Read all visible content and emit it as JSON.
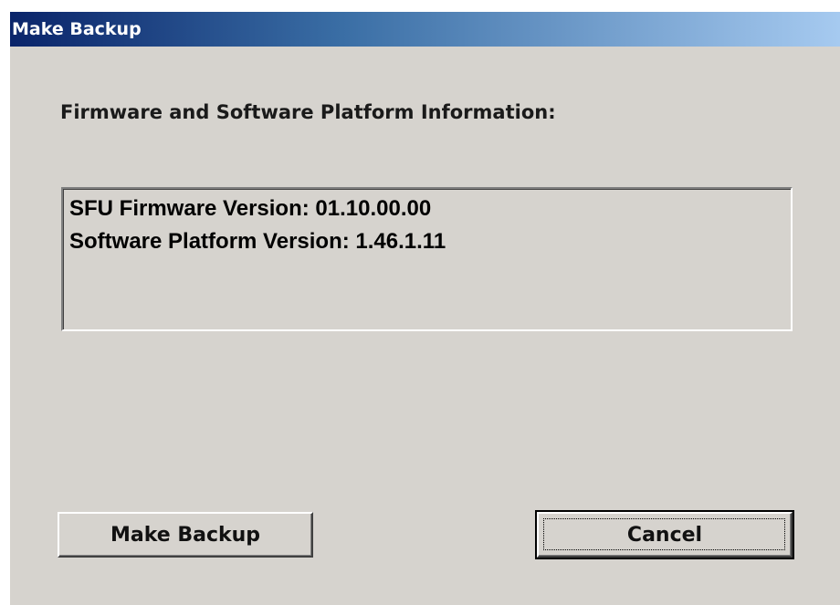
{
  "window": {
    "title": "Make Backup"
  },
  "section": {
    "label": "Firmware and Software Platform Information:"
  },
  "info": {
    "lines": [
      "SFU Firmware Version: 01.10.00.00",
      "Software Platform Version: 1.46.1.11"
    ]
  },
  "buttons": {
    "make_backup_label": "Make Backup",
    "cancel_label": "Cancel"
  },
  "colors": {
    "titlebar_start": "#0a246a",
    "titlebar_end": "#a6caf0",
    "dialog_background": "#d6d3ce"
  }
}
